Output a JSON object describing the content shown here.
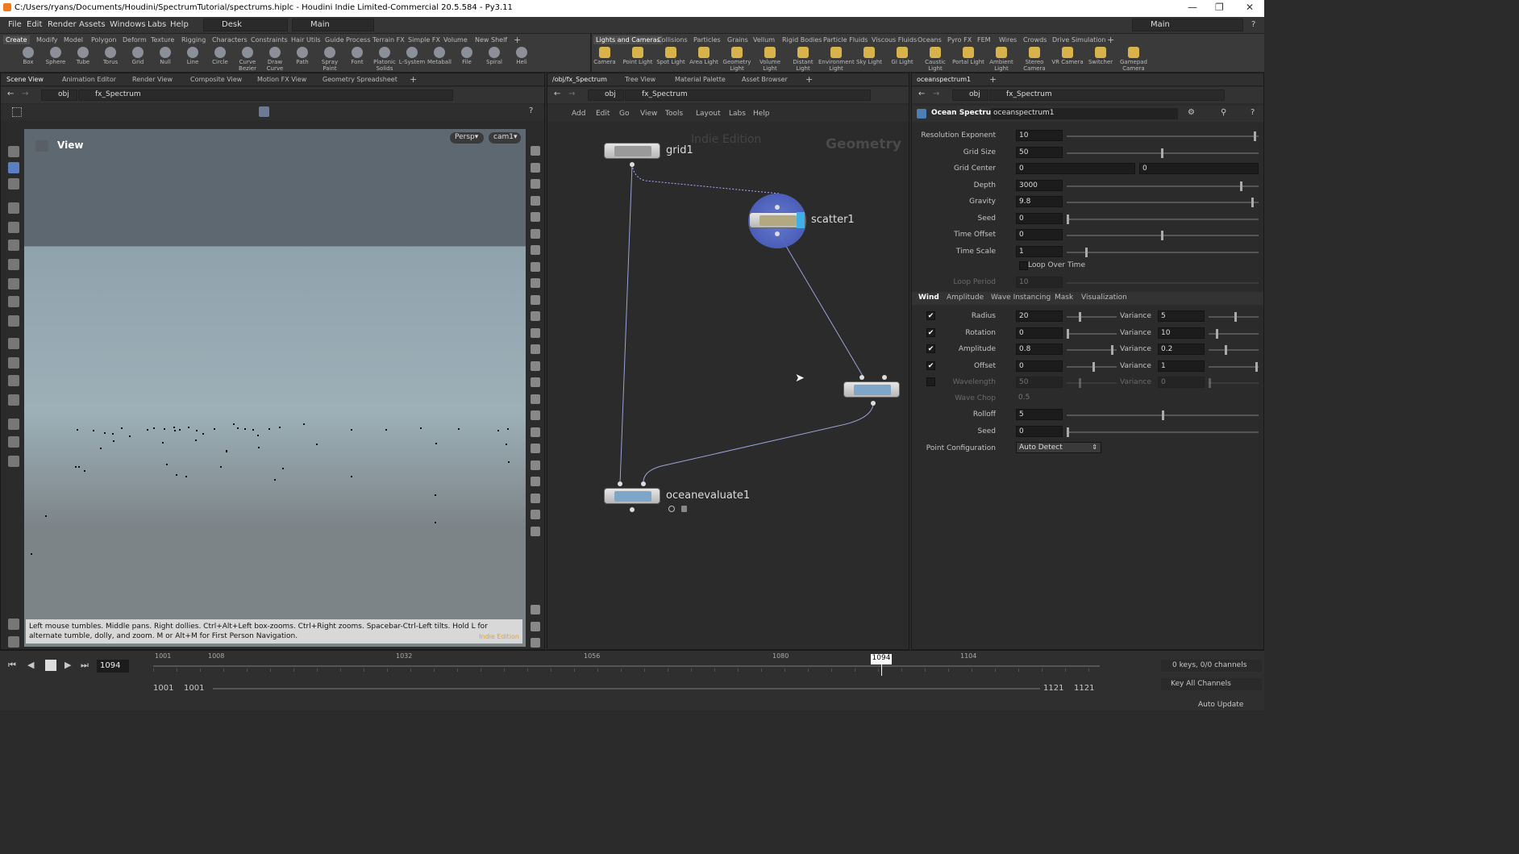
{
  "window": {
    "title": "C:/Users/ryans/Documents/Houdini/SpectrumTutorial/spectrums.hiplc - Houdini Indie Limited-Commercial 20.5.584 - Py3.11"
  },
  "menubar": {
    "items": [
      "File",
      "Edit",
      "Render",
      "Assets",
      "Windows",
      "Labs",
      "Help"
    ],
    "desk": "Desk",
    "main_left": "Main",
    "main_right": "Main"
  },
  "shelf_left": {
    "tabs": [
      "Create",
      "Modify",
      "Model",
      "Polygon",
      "Deform",
      "Texture",
      "Rigging",
      "Characters",
      "Constraints",
      "Hair Utils",
      "Guide Process",
      "Terrain FX",
      "Simple FX",
      "Volume",
      "New Shelf"
    ],
    "tools": [
      "Box",
      "Sphere",
      "Tube",
      "Torus",
      "Grid",
      "Null",
      "Line",
      "Circle",
      "Curve Bezier",
      "Draw Curve",
      "Path",
      "Spray Paint",
      "Font",
      "Platonic Solids",
      "L-System",
      "Metaball",
      "File",
      "Spiral",
      "Heli"
    ]
  },
  "shelf_right": {
    "tabs": [
      "Lights and Cameras",
      "Collisions",
      "Particles",
      "Grains",
      "Vellum",
      "Rigid Bodies",
      "Particle Fluids",
      "Viscous Fluids",
      "Oceans",
      "Pyro FX",
      "FEM",
      "Wires",
      "Crowds",
      "Drive Simulation"
    ],
    "tools": [
      "Camera",
      "Point Light",
      "Spot Light",
      "Area Light",
      "Geometry Light",
      "Volume Light",
      "Distant Light",
      "Environment Light",
      "Sky Light",
      "GI Light",
      "Caustic Light",
      "Portal Light",
      "Ambient Light",
      "Stereo Camera",
      "VR Camera",
      "Switcher",
      "Gamepad Camera"
    ]
  },
  "left_pane": {
    "tabs": [
      "Scene View",
      "Animation Editor",
      "Render View",
      "Composite View",
      "Motion FX View",
      "Geometry Spreadsheet"
    ],
    "path_root": "obj",
    "path": "fx_Spectrum",
    "view_title": "View",
    "persp": "Persp",
    "cam": "cam1",
    "status": "Left mouse tumbles. Middle pans. Right dollies. Ctrl+Alt+Left box-zooms. Ctrl+Right zooms. Spacebar-Ctrl-Left tilts. Hold L for alternate tumble, dolly, and zoom. M or Alt+M for First Person Navigation.",
    "watermark": "Indie Edition"
  },
  "network": {
    "tabs": [
      "/obj/fx_Spectrum",
      "Tree View",
      "Material Palette",
      "Asset Browser"
    ],
    "path_root": "obj",
    "path": "fx_Spectrum",
    "menu": [
      "Add",
      "Edit",
      "Go",
      "View",
      "Tools",
      "Layout",
      "Labs",
      "Help"
    ],
    "watermark": "Indie Edition",
    "context": "Geometry",
    "nodes": {
      "grid": "grid1",
      "scatter": "scatter1",
      "evaluate": "oceanevaluate1"
    }
  },
  "params": {
    "tab": "oceanspectrum1",
    "path_root": "obj",
    "path": "fx_Spectrum",
    "node_type": "Ocean Spectrum",
    "node_name": "oceanspectrum1",
    "rows": [
      {
        "label": "Resolution Exponent",
        "value": "10",
        "slider": 0.99
      },
      {
        "label": "Grid Size",
        "value": "50",
        "slider": 0.5
      },
      {
        "label": "Grid Center",
        "value": "0",
        "value2": "0"
      },
      {
        "label": "Depth",
        "value": "3000",
        "slider": 0.92
      },
      {
        "label": "Gravity",
        "value": "9.8",
        "slider": 0.98
      },
      {
        "label": "Seed",
        "value": "0",
        "slider": 0.0
      },
      {
        "label": "Time Offset",
        "value": "0",
        "slider": 0.5
      },
      {
        "label": "Time Scale",
        "value": "1",
        "slider": 0.1
      }
    ],
    "loop_over_time": "Loop Over Time",
    "loop_period_label": "Loop Period",
    "loop_period": "10",
    "subtabs": [
      "Wind",
      "Amplitude",
      "Wave Instancing",
      "Mask",
      "Visualization"
    ],
    "wind_rows": [
      {
        "label": "Radius",
        "value": "20",
        "variance": "5",
        "checked": true
      },
      {
        "label": "Rotation",
        "value": "0",
        "variance": "10",
        "checked": true
      },
      {
        "label": "Amplitude",
        "value": "0.8",
        "variance": "0.2",
        "checked": true
      },
      {
        "label": "Offset",
        "value": "0",
        "variance": "1",
        "checked": true
      },
      {
        "label": "Wavelength",
        "value": "50",
        "variance": "0",
        "checked": false
      }
    ],
    "variance_label": "Variance",
    "wave_chop_label": "Wave Chop",
    "wave_chop": "0.5",
    "rolloff_label": "Rolloff",
    "rolloff": "5",
    "seed_label": "Seed",
    "seed": "0",
    "point_config_label": "Point Configuration",
    "point_config": "Auto Detect"
  },
  "timeline": {
    "current_frame": "1094",
    "ticks": [
      "1001",
      "1008",
      "1032",
      "1056",
      "1080",
      "1104"
    ],
    "marker": "1094",
    "start": "1001",
    "start2": "1001",
    "end": "1121",
    "end2": "1121",
    "keys": "0 keys, 0/0 channels",
    "key_all": "Key All Channels",
    "auto_update": "Auto Update"
  }
}
